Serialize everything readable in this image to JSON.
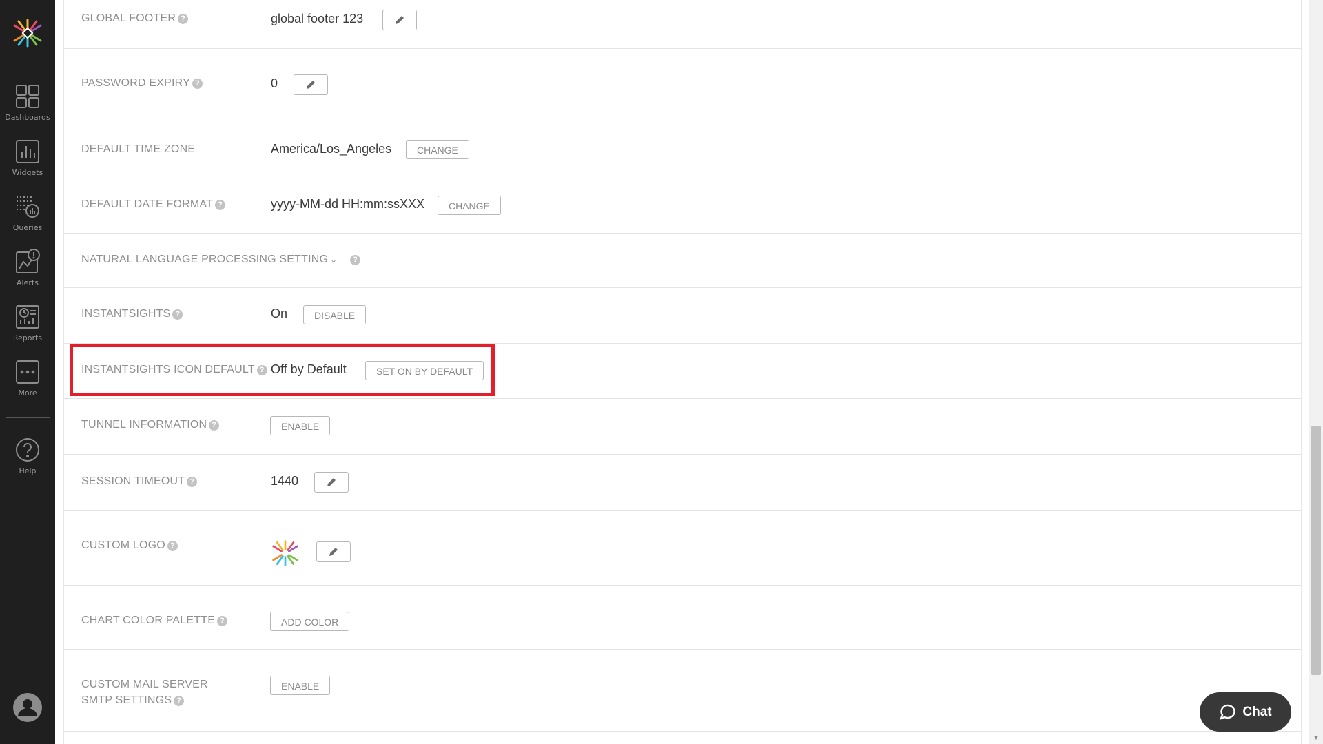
{
  "nav": {
    "items": [
      {
        "label": "Dashboards",
        "icon": "dashboards-icon"
      },
      {
        "label": "Widgets",
        "icon": "widgets-icon"
      },
      {
        "label": "Queries",
        "icon": "queries-icon"
      },
      {
        "label": "Alerts",
        "icon": "alerts-icon"
      },
      {
        "label": "Reports",
        "icon": "reports-icon"
      },
      {
        "label": "More",
        "icon": "more-icon"
      },
      {
        "label": "Help",
        "icon": "help-icon"
      }
    ]
  },
  "settings": {
    "global_footer": {
      "label": "GLOBAL FOOTER",
      "value": "global footer 123"
    },
    "password_expiry": {
      "label": "PASSWORD EXPIRY",
      "value": "0"
    },
    "default_time_zone": {
      "label": "DEFAULT TIME ZONE",
      "value": "America/Los_Angeles",
      "button": "CHANGE"
    },
    "default_date_format": {
      "label": "DEFAULT DATE FORMAT",
      "value": "yyyy-MM-dd HH:mm:ssXXX",
      "button": "CHANGE"
    },
    "nlp_setting": {
      "label": "NATURAL LANGUAGE PROCESSING SETTING"
    },
    "instantsights": {
      "label": "INSTANTSIGHTS",
      "value": "On",
      "button": "DISABLE"
    },
    "instantsights_icon_default": {
      "label": "INSTANTSIGHTS ICON DEFAULT",
      "value": "Off by Default",
      "button": "SET ON BY DEFAULT"
    },
    "tunnel_information": {
      "label": "TUNNEL INFORMATION",
      "button": "ENABLE"
    },
    "session_timeout": {
      "label": "SESSION TIMEOUT",
      "value": "1440"
    },
    "custom_logo": {
      "label": "CUSTOM LOGO"
    },
    "chart_color_palette": {
      "label": "CHART COLOR PALETTE",
      "button": "ADD COLOR"
    },
    "custom_mail_server": {
      "label_line1": "CUSTOM MAIL SERVER",
      "label_line2": "SMTP SETTINGS",
      "button": "ENABLE"
    }
  },
  "help_glyph": "?",
  "chat": {
    "label": "Chat"
  },
  "colors": {
    "sidebar": "#1f1f1f",
    "highlight": "#e3202a",
    "chat": "#383838"
  }
}
